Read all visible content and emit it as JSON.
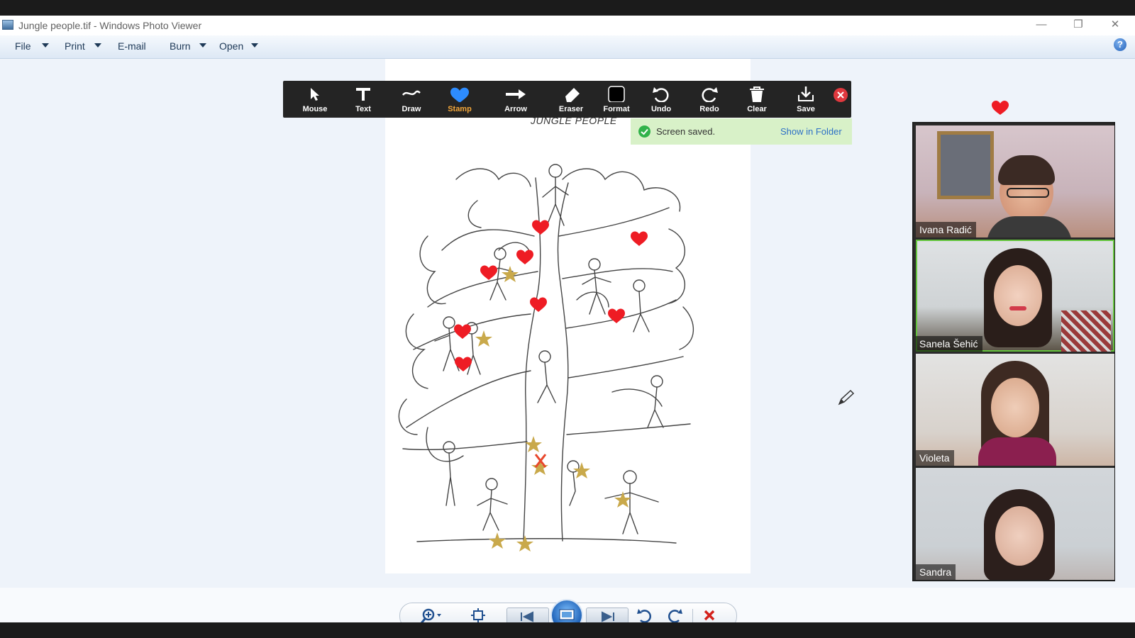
{
  "window": {
    "title": "Jungle people.tif - Windows Photo Viewer",
    "minimize": "—",
    "restore": "❐",
    "close": "✕"
  },
  "menu": {
    "file": "File",
    "print": "Print",
    "email": "E-mail",
    "burn": "Burn",
    "open": "Open",
    "help": "?"
  },
  "document": {
    "title": "JUNGLE PEOPLE"
  },
  "annotation_toolbar": {
    "tools": [
      {
        "label": "Mouse"
      },
      {
        "label": "Text"
      },
      {
        "label": "Draw"
      },
      {
        "label": "Stamp"
      },
      {
        "label": "Arrow"
      },
      {
        "label": "Eraser"
      },
      {
        "label": "Format"
      },
      {
        "label": "Undo"
      },
      {
        "label": "Redo"
      },
      {
        "label": "Clear"
      },
      {
        "label": "Save"
      }
    ],
    "active": "Stamp",
    "accent": "#f2a63a"
  },
  "notification": {
    "message": "Screen saved.",
    "link": "Show in Folder"
  },
  "participants": [
    {
      "name": "Ivana Radić"
    },
    {
      "name": "Sanela Šehić"
    },
    {
      "name": "Violeta"
    },
    {
      "name": "Sandra"
    }
  ],
  "icons": {
    "search": "zoom-icon",
    "fit": "actual-size-icon",
    "previous": "previous-icon",
    "slideshow": "slideshow-icon",
    "next": "next-icon",
    "rotate_left": "rotate-counterclockwise-icon",
    "rotate_right": "rotate-clockwise-icon",
    "delete": "delete-icon"
  },
  "colors": {
    "stamp_heart": "#ee1c24",
    "stamp_star": "#c9a94b",
    "speaking_border": "#64c43d"
  }
}
